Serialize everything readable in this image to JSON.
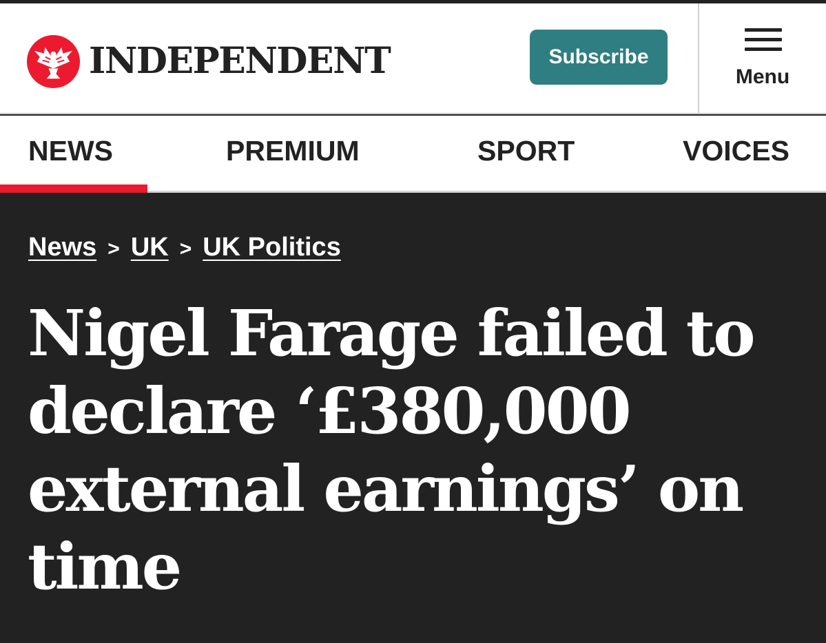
{
  "header": {
    "brand": "INDEPENDENT",
    "subscribe_label": "Subscribe",
    "menu_label": "Menu",
    "logo_icon": "eagle-logo-icon",
    "menu_icon": "hamburger-icon"
  },
  "nav": {
    "active": "NEWS",
    "items": [
      {
        "label": "NEWS"
      },
      {
        "label": "PREMIUM"
      },
      {
        "label": "SPORT"
      },
      {
        "label": "VOICES"
      }
    ]
  },
  "breadcrumb": {
    "items": [
      {
        "label": "News"
      },
      {
        "label": "UK"
      },
      {
        "label": "UK Politics"
      }
    ],
    "separator": ">"
  },
  "article": {
    "headline": "Nigel Farage failed to declare ‘£380,000 external earnings’ on time"
  },
  "colors": {
    "brand_red": "#ec1a2e",
    "subscribe_teal": "#2f7e81",
    "hero_background": "#222222",
    "text_dark": "#222222"
  }
}
